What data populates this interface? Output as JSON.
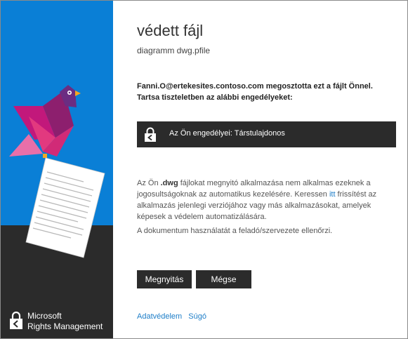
{
  "header": {
    "title": "védett fájl",
    "filename": "diagramm dwg.pfile"
  },
  "share_message": "Fanni.O@ertekesites.contoso.com megosztotta ezt a fájlt Önnel. Tartsa tiszteletben az alábbi engedélyeket:",
  "permission": {
    "label": "Az Ön engedélyei: Társtulajdonos"
  },
  "info": {
    "part1": "Az Ön ",
    "ext": ".dwg",
    "part2": " fájlokat megnyitó alkalmazása nem alkalmas ezeknek a jogosultságoknak az automatikus kezelésére. Keressen ",
    "link": "itt",
    "part3": " frissítést az alkalmazás jelenlegi verziójához vagy más alkalmazásokat, amelyek képesek a védelem automatizálására."
  },
  "control_text": "A dokumentum használatát a feladó/szervezete ellenőrzi.",
  "buttons": {
    "open": "Megnyitás",
    "cancel": "Mégse"
  },
  "footer": {
    "privacy": "Adatvédelem",
    "help": "Súgó"
  },
  "brand": {
    "line1": "Microsoft",
    "line2": "Rights Management"
  },
  "colors": {
    "side_blue": "#0a7fd6",
    "dark": "#2b2b2b",
    "link": "#1e7ec8",
    "bird_magenta": "#c2187b",
    "bird_pink": "#e2397f",
    "bird_purple": "#6b2d82"
  },
  "icons": {
    "permission": "lock-icon",
    "brand": "rights-management-logo-icon"
  }
}
